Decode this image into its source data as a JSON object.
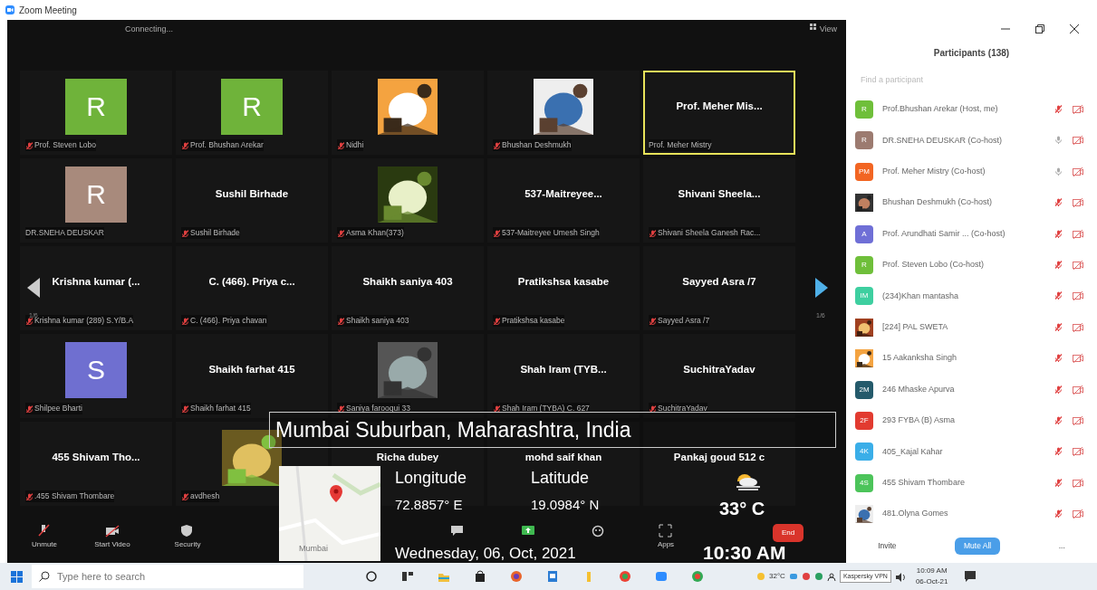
{
  "window": {
    "title": "Zoom Meeting"
  },
  "meeting": {
    "status": "Connecting...",
    "view_button": "View",
    "page_left": "1/6",
    "page_right": "1/6",
    "tiles": [
      {
        "kind": "letter",
        "letter": "R",
        "color": "#6fb33a",
        "label": "Prof. Steven Lobo",
        "muted": true,
        "active": false
      },
      {
        "kind": "letter",
        "letter": "R",
        "color": "#6fb33a",
        "label": "Prof. Bhushan Arekar",
        "muted": true,
        "active": false
      },
      {
        "kind": "picture",
        "label": "Nidhi",
        "muted": true,
        "active": false
      },
      {
        "kind": "picture",
        "label": "Bhushan Deshmukh",
        "muted": true,
        "active": false
      },
      {
        "kind": "name",
        "name": "Prof. Meher Mis...",
        "label": "Prof. Meher Mistry",
        "muted": false,
        "active": true
      },
      {
        "kind": "letter",
        "letter": "R",
        "color": "#a88a7c",
        "label": "DR.SNEHA DEUSKAR",
        "muted": false,
        "active": false
      },
      {
        "kind": "name",
        "name": "Sushil Birhade",
        "label": "Sushil Birhade",
        "muted": true,
        "active": false
      },
      {
        "kind": "picture",
        "label": "Asma Khan(373)",
        "muted": true,
        "active": false
      },
      {
        "kind": "name",
        "name": "537-Maitreyee...",
        "label": "537-Maitreyee Umesh Singh",
        "muted": true,
        "active": false
      },
      {
        "kind": "name",
        "name": "Shivani  Sheela...",
        "label": "Shivani Sheela Ganesh Rac...",
        "muted": true,
        "active": false
      },
      {
        "kind": "name",
        "name": "Krishna kumar (...",
        "label": "Krishna kumar (289) S.Y/B.A",
        "muted": true,
        "active": false
      },
      {
        "kind": "name",
        "name": "C. (466). Priya c...",
        "label": "C. (466). Priya chavan",
        "muted": true,
        "active": false
      },
      {
        "kind": "name",
        "name": "Shaikh saniya 403",
        "label": "Shaikh saniya 403",
        "muted": true,
        "active": false
      },
      {
        "kind": "name",
        "name": "Pratikshsa kasabe",
        "label": "Pratikshsa kasabe",
        "muted": true,
        "active": false
      },
      {
        "kind": "name",
        "name": "Sayyed Asra /7",
        "label": "Sayyed Asra /7",
        "muted": true,
        "active": false
      },
      {
        "kind": "letter",
        "letter": "S",
        "color": "#6f6fd0",
        "label": "Shilpee Bharti",
        "muted": true,
        "active": false
      },
      {
        "kind": "name",
        "name": "Shaikh farhat 415",
        "label": "Shaikh farhat 415",
        "muted": true,
        "active": false
      },
      {
        "kind": "picture",
        "label": "Saniya farooqui 33",
        "muted": true,
        "active": false
      },
      {
        "kind": "name",
        "name": "Shah Iram  (TYB...",
        "label": "Shah Iram  (TYBA) C. 627",
        "muted": true,
        "active": false
      },
      {
        "kind": "name",
        "name": "SuchitraYadav",
        "label": "SuchitraYadav",
        "muted": true,
        "active": false
      },
      {
        "kind": "name",
        "name": "455 Shivam Tho...",
        "label": ".455 Shivam Thombare",
        "muted": true,
        "active": false
      },
      {
        "kind": "picture",
        "label": "avdhesh",
        "muted": true,
        "active": false
      },
      {
        "kind": "name",
        "name": "Richa dubey",
        "active": false
      },
      {
        "kind": "name",
        "name": "mohd saif khan",
        "active": false
      },
      {
        "kind": "name",
        "name": "Pankaj goud 512 c",
        "active": false
      }
    ],
    "toolbar": [
      {
        "kind": "unmute",
        "label": "Unmute"
      },
      {
        "kind": "video",
        "label": "Start Video"
      },
      {
        "kind": "security",
        "label": "Security"
      },
      {
        "kind": "spacer"
      },
      {
        "kind": "chat"
      },
      {
        "kind": "share"
      },
      {
        "kind": "reactions"
      },
      {
        "kind": "apps",
        "label": "Apps"
      },
      {
        "kind": "spacer"
      },
      {
        "kind": "end",
        "label": "End"
      }
    ]
  },
  "geotag": {
    "location": "Mumbai Suburban, Maharashtra, India",
    "map_label": "Mumbai",
    "longitude_label": "Longitude",
    "longitude": "72.8857° E",
    "latitude_label": "Latitude",
    "latitude": "19.0984° N",
    "temperature": "33° C",
    "date": "Wednesday, 06, Oct, 2021",
    "time": "10:30 AM"
  },
  "participants": {
    "title": "Participants (138)",
    "search": {
      "placeholder": "Find a participant"
    },
    "items": [
      {
        "kind": "initials",
        "initials": "R",
        "color": "#6fbf3a",
        "name": "Prof.Bhushan Arekar (Host, me)",
        "muted": true
      },
      {
        "kind": "initials",
        "initials": "R",
        "color": "#9c7b70",
        "name": "DR.SNEHA DEUSKAR (Co-host)",
        "muted": false
      },
      {
        "kind": "initials",
        "initials": "PM",
        "color": "#f26522",
        "name": "Prof. Meher Mistry (Co-host)",
        "muted": false
      },
      {
        "kind": "picture",
        "name": "Bhushan Deshmukh (Co-host)",
        "muted": true
      },
      {
        "kind": "initials",
        "initials": "A",
        "color": "#6f6fd6",
        "name": "Prof. Arundhati Samir ... (Co-host)",
        "muted": true
      },
      {
        "kind": "initials",
        "initials": "R",
        "color": "#6fbf3a",
        "name": "Prof. Steven Lobo (Co-host)",
        "muted": true
      },
      {
        "kind": "initials",
        "initials": "IM",
        "color": "#3ecfa0",
        "name": "(234)Khan mantasha",
        "muted": true
      },
      {
        "kind": "picture",
        "name": "[224] PAL SWETA",
        "muted": true
      },
      {
        "kind": "picture",
        "name": "15 Aakanksha Singh",
        "muted": true
      },
      {
        "kind": "initials",
        "initials": "2M",
        "color": "#245a6b",
        "name": "246 Mhaske Apurva",
        "muted": true
      },
      {
        "kind": "initials",
        "initials": "2F",
        "color": "#e23b30",
        "name": "293 FYBA (B) Asma",
        "muted": true
      },
      {
        "kind": "initials",
        "initials": "4K",
        "color": "#3aaee8",
        "name": "405_Kajal Kahar",
        "muted": true
      },
      {
        "kind": "initials",
        "initials": "4S",
        "color": "#4cc45a",
        "name": "455 Shivam Thombare",
        "muted": true
      },
      {
        "kind": "picture",
        "name": "481.Olyna Gomes",
        "muted": true
      }
    ],
    "buttons": [
      {
        "kind": "link",
        "label": "Invite"
      },
      {
        "kind": "primary",
        "label": "Mute All"
      },
      {
        "kind": "link",
        "label": "..."
      }
    ]
  },
  "taskbar": {
    "search": {
      "placeholder": "Type here to search"
    },
    "weather": "32°C",
    "tooltip": "Kaspersky VPN",
    "time": "10:09 AM",
    "date": "06-Oct-21"
  }
}
